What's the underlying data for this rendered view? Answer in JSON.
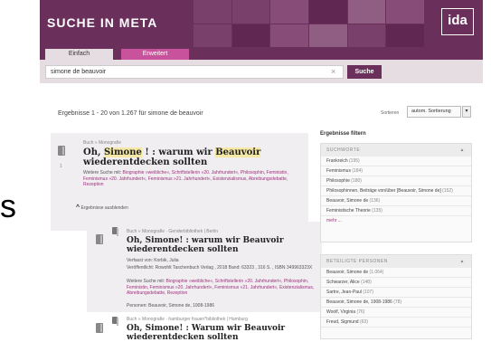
{
  "header": {
    "site_title": "SUCHE IN META",
    "logo_text": "ida"
  },
  "tabs": [
    {
      "label": "Einfach",
      "active": true
    },
    {
      "label": "Erweitert",
      "active": false
    }
  ],
  "search": {
    "value": "simone de beauvoir",
    "clear_icon": "×",
    "button_label": "Suche"
  },
  "results_bar": {
    "count_text": "Ergebnisse 1 - 20 von 1.267 für simone de beauvoir",
    "sort_label": "Sortieren",
    "sort_value": "autom. Sortierung",
    "sort_arrow": "▾"
  },
  "result": {
    "type": "Buch » Monografie",
    "title_pre": "Oh, ",
    "title_hl1": "Simone",
    "title_mid": " ! : warum wir ",
    "title_hl2": "Beauvoir",
    "title_post": " wiederentdecken sollten",
    "number": "1",
    "more_label": "Weitere Suche mit:",
    "more_text": "Biographie »weibliche«, Schriftstellerin »20. Jahrhundert«, Philosophin, Feministin, Feminismus »20. Jahrhundert«, Feminismus »21. Jahrhundert«, Existenzialismus, Abreibungsdebatte, Rezeption"
  },
  "toggle": {
    "icon": "^",
    "label": "Ergebnisse ausblenden"
  },
  "subresults": [
    {
      "type": "Buch » Monografie · Genderbibliothek | Berlin",
      "title": "Oh, Simone! : warum wir Beauvoir wiederentdecken sollten",
      "author": "Verfasst von: Korbik, Julia",
      "published": "Veröffentlicht: Rowohlt Taschenbuch Verlag , 2018 Band: 63323 , 316 S. , ISBN 349963323X",
      "more_label": "Weitere Suche mit:",
      "more_text": "Biographie »weibliche«, Schriftstellerin »20. Jahrhundert«, Philosophin, Feministin, Feminismus »20. Jahrhundert«, Feminismus »21. Jahrhundert«, Existenzialismus, Abreibungsdebatte, Rezeption",
      "persons": "Personen: Beauvoir, Simone de, 1908-1986"
    },
    {
      "type": "Buch » Monografie · hamburger frauen*bibliothek | Hamburg",
      "title": "Oh, Simone! : Warum wir Beauvoir wiederentdecken sollten"
    }
  ],
  "facets": {
    "heading": "Ergebnisse filtern",
    "keywords": {
      "title": "SUCHWORTE",
      "arrow": "▲",
      "items": [
        {
          "label": "Frankreich",
          "count": "(195)"
        },
        {
          "label": "Feminismus",
          "count": "(184)"
        },
        {
          "label": "Philosophie",
          "count": "(180)"
        },
        {
          "label": "Philosophinnen, Beiträge von/über [Beauvoir, Simone de]",
          "count": "(152)"
        },
        {
          "label": "Beauvoir, Simone de",
          "count": "(136)"
        },
        {
          "label": "Feministische Theorie",
          "count": "(135)"
        }
      ],
      "more": "mehr ..."
    },
    "persons": {
      "title": "BETEILIGTE PERSONEN",
      "arrow": "▲",
      "items": [
        {
          "label": "Beauvoir, Simone de",
          "count": "(1.064)"
        },
        {
          "label": "Schwarzer, Alice",
          "count": "(148)"
        },
        {
          "label": "Sartre, Jean-Paul",
          "count": "(107)"
        },
        {
          "label": "Beauvoir, Simone de, 1908-1986",
          "count": "(78)"
        },
        {
          "label": "Woolf, Virginia",
          "count": "(76)"
        },
        {
          "label": "Freud, Sigmund",
          "count": "(63)"
        }
      ]
    }
  },
  "edge_glyph": "s",
  "colors": {
    "banner": "#6a2f5b",
    "tab_inactive": "#c8529b",
    "link": "#a0307f",
    "highlight": "#f5e8a4"
  }
}
